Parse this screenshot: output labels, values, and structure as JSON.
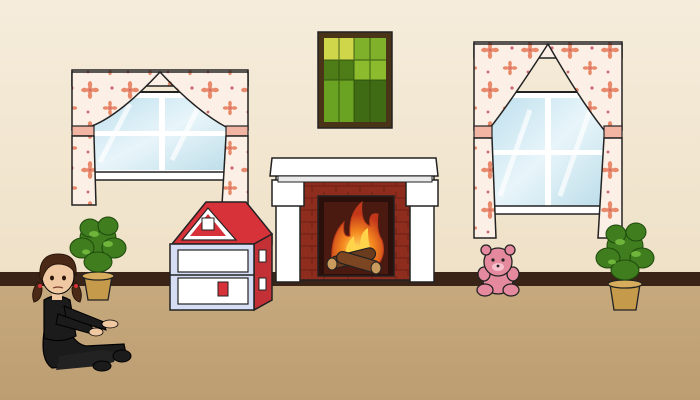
{
  "scene": {
    "name": "living-room",
    "colors": {
      "wall": "#f3e8d4",
      "floor": "#c4a57b",
      "baseboard": "#3a2418",
      "curtain": "#fbeee6",
      "flower": "#e7896a",
      "glass": "#d5eaf3",
      "mantel": "#ffffff",
      "brick": "#8b2a1c",
      "fire": "#f07a1a",
      "painting_frame": "#4a3418",
      "painting": "#5e9420",
      "dollhouse_roof": "#d7323a",
      "dollhouse_wall": "#d6def6",
      "teddy": "#e58a9e",
      "plant_leaf": "#3f7d1f",
      "pot": "#c69a4b",
      "girl_outfit": "#1b1b1b",
      "girl_hair": "#4a2a16",
      "skin": "#f0c9a3"
    }
  }
}
